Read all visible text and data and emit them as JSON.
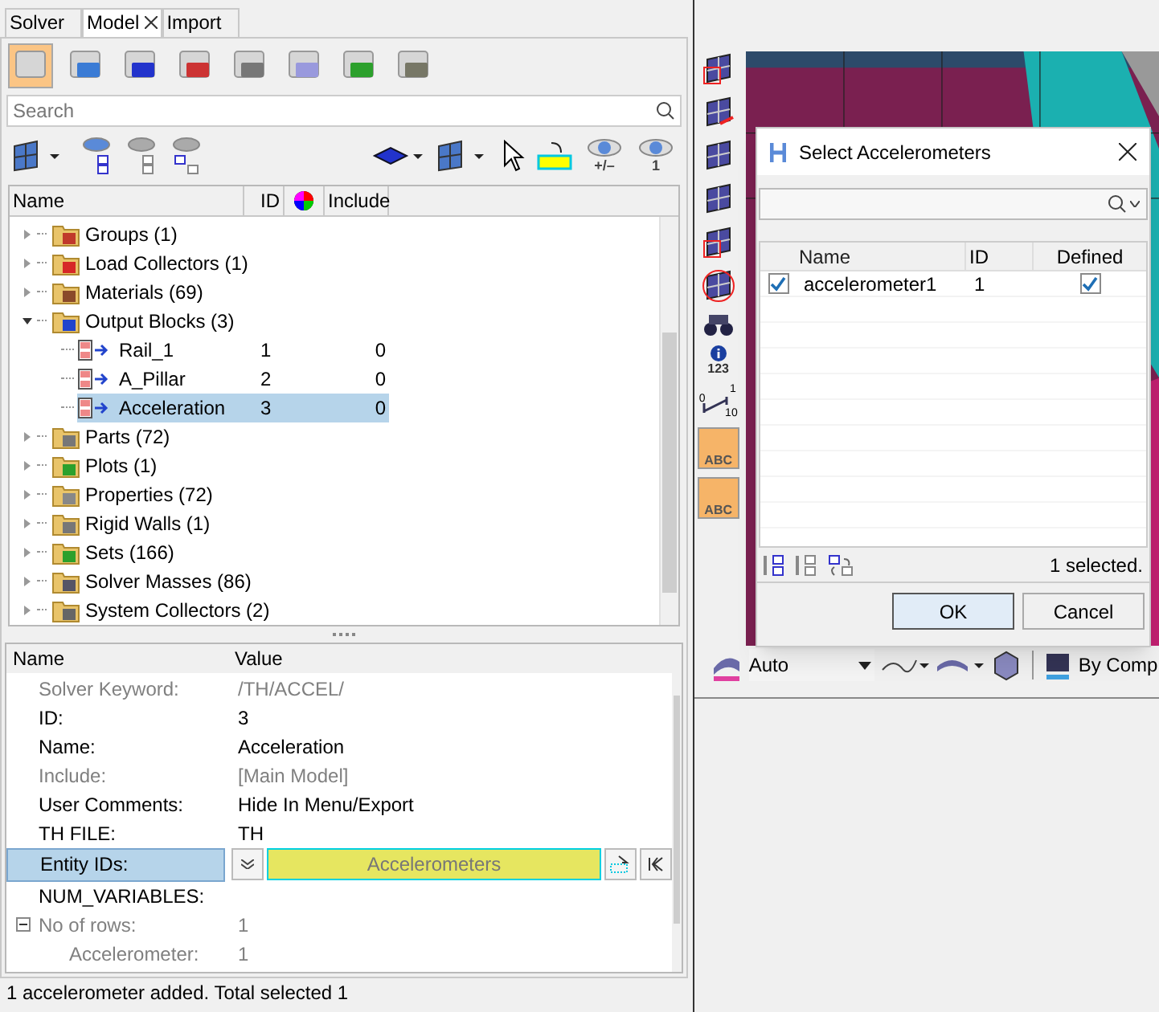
{
  "tabs": [
    {
      "label": "Solver",
      "selected": false
    },
    {
      "label": "Model",
      "selected": true
    },
    {
      "label": "Import",
      "selected": false
    }
  ],
  "entity_buttons": [
    {
      "selected": true
    },
    {
      "selected": false
    },
    {
      "selected": false
    },
    {
      "selected": false
    },
    {
      "selected": false
    },
    {
      "selected": false
    },
    {
      "selected": false
    },
    {
      "selected": false
    }
  ],
  "search": {
    "placeholder": "Search"
  },
  "eye_captions": [
    "+/–",
    "1"
  ],
  "tree": {
    "columns": [
      "Name",
      "ID",
      "Include"
    ],
    "items": [
      {
        "label": "Groups (1)",
        "expanded": false
      },
      {
        "label": "Load Collectors (1)",
        "expanded": false
      },
      {
        "label": "Materials (69)",
        "expanded": false
      },
      {
        "label": "Output Blocks (3)",
        "expanded": true,
        "children": [
          {
            "label": "Rail_1",
            "id": "1",
            "include": "0",
            "selected": false
          },
          {
            "label": "A_Pillar",
            "id": "2",
            "include": "0",
            "selected": false
          },
          {
            "label": "Acceleration",
            "id": "3",
            "include": "0",
            "selected": true
          }
        ]
      },
      {
        "label": "Parts (72)",
        "expanded": false
      },
      {
        "label": "Plots (1)",
        "expanded": false
      },
      {
        "label": "Properties (72)",
        "expanded": false
      },
      {
        "label": "Rigid Walls (1)",
        "expanded": false
      },
      {
        "label": "Sets (166)",
        "expanded": false
      },
      {
        "label": "Solver Masses (86)",
        "expanded": false
      },
      {
        "label": "System Collectors (2)",
        "expanded": false
      }
    ]
  },
  "properties": {
    "columns": [
      "Name",
      "Value"
    ],
    "rows": [
      {
        "kind": "text",
        "name": "Solver Keyword:",
        "value": "/TH/ACCEL/",
        "disabled": true
      },
      {
        "kind": "text",
        "name": "ID:",
        "value": "3",
        "disabled": false
      },
      {
        "kind": "text",
        "name": "Name:",
        "value": "Acceleration",
        "disabled": false
      },
      {
        "kind": "text",
        "name": "Include:",
        "value": "[Main Model]",
        "disabled": true
      },
      {
        "kind": "text",
        "name": "User Comments:",
        "value": "Hide In Menu/Export",
        "disabled": false
      },
      {
        "kind": "text",
        "name": "TH FILE:",
        "value": "TH",
        "disabled": false
      },
      {
        "kind": "selector",
        "name": "Entity IDs:",
        "value": "Accelerometers",
        "disabled": false,
        "selected": true
      },
      {
        "kind": "text",
        "name": "NUM_VARIABLES:",
        "disabled": false
      },
      {
        "kind": "group",
        "name": "No of rows:",
        "value": "1",
        "disabled": true,
        "expanded": true,
        "children": [
          {
            "kind": "text",
            "name": "Accelerometer:",
            "value": "1",
            "disabled": true
          }
        ]
      }
    ]
  },
  "status_bar": "1 accelerometer added. Total selected 1",
  "side_toolbar": {
    "info_caption": "123",
    "scale_labels": [
      "0",
      "1",
      "10"
    ],
    "label_buttons": [
      "ABC",
      "ABC"
    ]
  },
  "view_toolbar": {
    "mode": "Auto",
    "color_by": "By Comp"
  },
  "dialog": {
    "title": "Select Accelerometers",
    "columns": [
      "Name",
      "ID",
      "Defined"
    ],
    "rows": [
      {
        "checked": true,
        "name": "accelerometer1",
        "id": "1",
        "defined": true
      }
    ],
    "count": "1 selected.",
    "buttons": [
      "OK",
      "Cancel"
    ]
  }
}
